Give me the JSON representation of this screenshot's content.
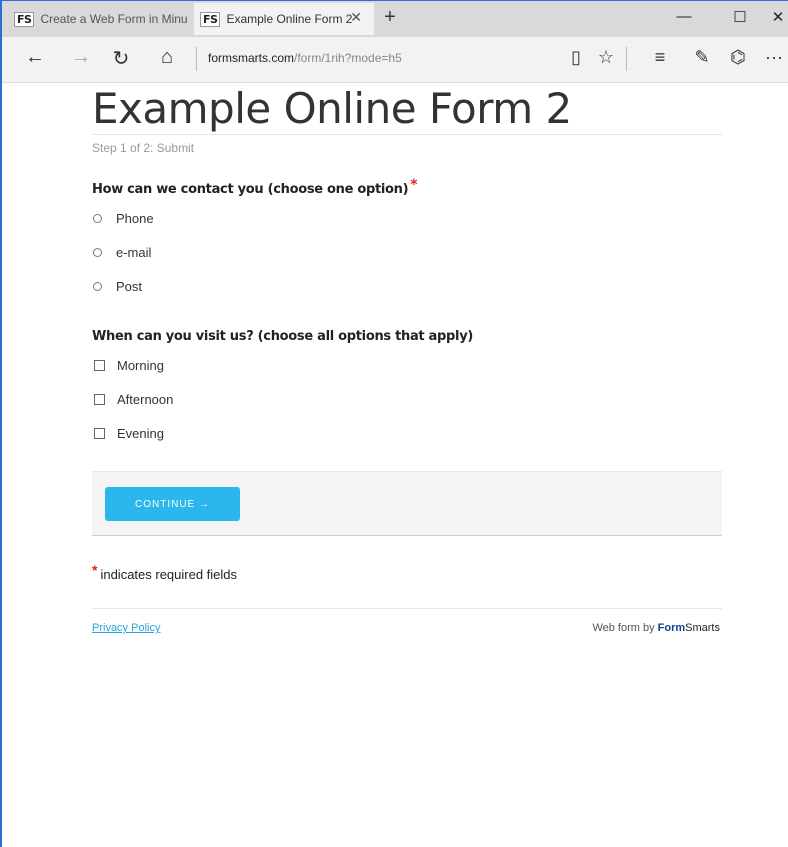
{
  "browser": {
    "tabs": [
      {
        "label": "Create a Web Form in Minu",
        "logo": "FS",
        "active": false
      },
      {
        "label": "Example Online Form 2",
        "logo": "FS",
        "active": true
      }
    ],
    "new_tab_glyph": "+",
    "tab_close_glyph": "✕",
    "window_controls": {
      "minimize": "—",
      "maximize": "☐",
      "close": "✕"
    },
    "nav": {
      "back": "←",
      "forward": "→",
      "refresh": "↻",
      "home": "⌂"
    },
    "address": {
      "host": "formsmarts.com",
      "path": "/form/1rih?mode=h5"
    },
    "tools": {
      "reading_view": "▯",
      "favorite": "☆",
      "hub": "≡",
      "notes": "✎",
      "share": "⌬",
      "more": "···"
    }
  },
  "form": {
    "title": "Example Online Form 2",
    "step": "Step 1 of 2: Submit",
    "questions": [
      {
        "label": "How can we contact you (choose one option)",
        "required": true,
        "type": "radio",
        "options": [
          "Phone",
          "e-mail",
          "Post"
        ]
      },
      {
        "label": "When can you visit us? (choose all options that apply)",
        "required": false,
        "type": "checkbox",
        "options": [
          "Morning",
          "Afternoon",
          "Evening"
        ]
      }
    ],
    "required_marker": "*",
    "continue_label": "CONTINUE →",
    "required_note": "indicates required fields"
  },
  "footer": {
    "privacy": "Privacy Policy",
    "webform_by": "Web form by",
    "brand_form": "Form",
    "brand_smarts": "Smarts"
  },
  "colors": {
    "accent": "#2cb7ec",
    "required": "#e02020",
    "link": "#2aa4d8",
    "brand": "#1b3f8f"
  }
}
